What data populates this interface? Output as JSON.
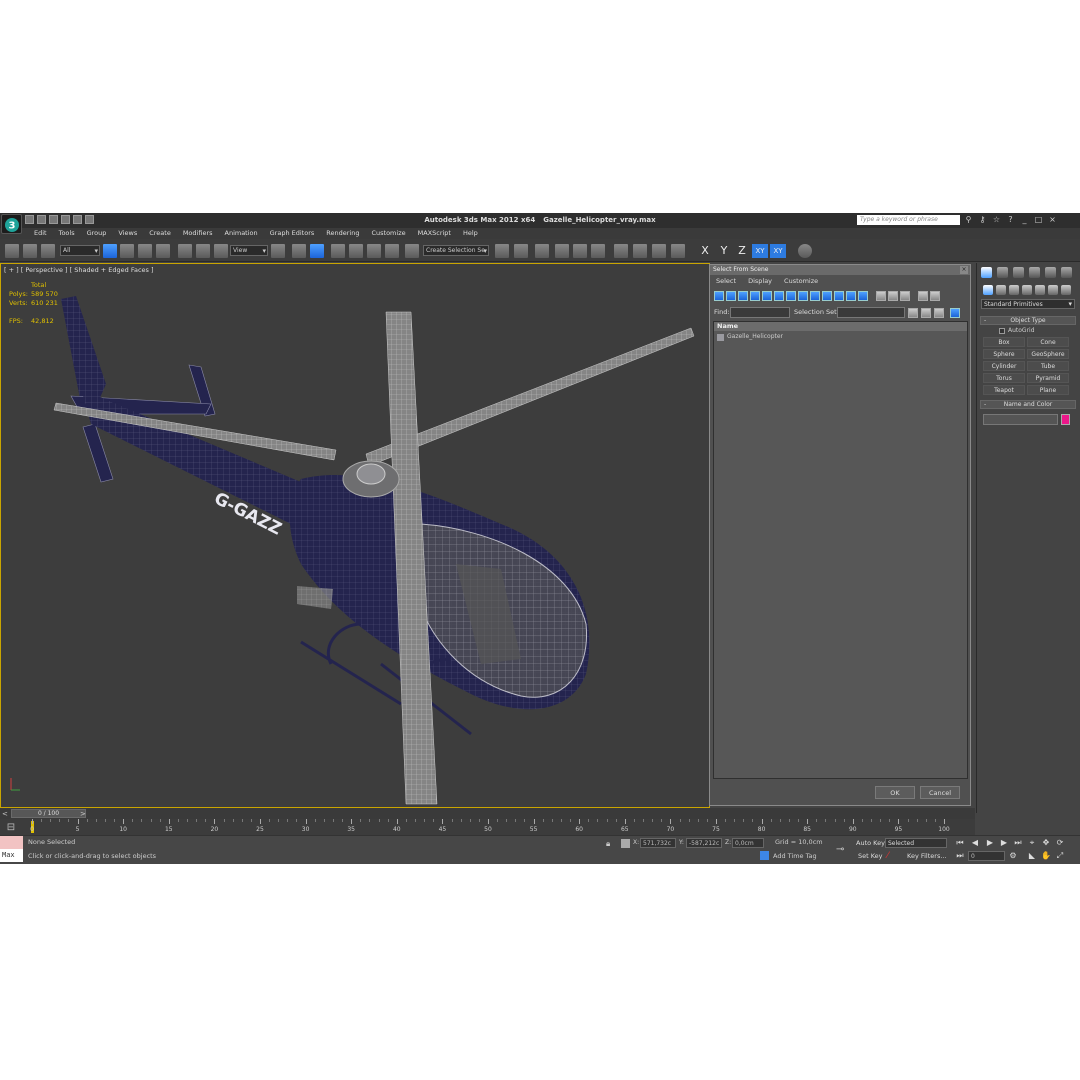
{
  "app": {
    "title": "Autodesk 3ds Max  2012 x64",
    "filename": "Gazelle_Helicopter_vray.max",
    "search_placeholder": "Type a keyword or phrase"
  },
  "menu": [
    "Edit",
    "Tools",
    "Group",
    "Views",
    "Create",
    "Modifiers",
    "Animation",
    "Graph Editors",
    "Rendering",
    "Customize",
    "MAXScript",
    "Help"
  ],
  "toolbar": {
    "filter_value": "All",
    "refcoord_value": "View",
    "named_selection_value": "Create Selection Se",
    "axes": [
      "X",
      "Y",
      "Z",
      "XY",
      "XY"
    ]
  },
  "viewport": {
    "label": "[ + ] [ Perspective ] [ Shaded + Edged Faces ]",
    "stats": {
      "header": "Total",
      "polys_label": "Polys:",
      "polys_value": "589 570",
      "verts_label": "Verts:",
      "verts_value": "610 231",
      "fps_label": "FPS:",
      "fps_value": "42,812"
    },
    "registration": "G-GAZZ"
  },
  "dialog": {
    "title": "Select From Scene",
    "menu": [
      "Select",
      "Display",
      "Customize"
    ],
    "find_label": "Find:",
    "selection_set_label": "Selection Set:",
    "column_name": "Name",
    "items": [
      "Gazelle_Helicopter"
    ],
    "ok_label": "OK",
    "cancel_label": "Cancel"
  },
  "command_panel": {
    "dropdown_value": "Standard Primitives",
    "object_type_title": "Object Type",
    "autogrid_label": "AutoGrid",
    "buttons": [
      "Box",
      "Cone",
      "Sphere",
      "GeoSphere",
      "Cylinder",
      "Tube",
      "Torus",
      "Pyramid",
      "Teapot",
      "Plane"
    ],
    "name_color_title": "Name and Color",
    "swatch_color": "#ec178a"
  },
  "timeline": {
    "slider_label": "0 / 100",
    "ticks": [
      "0",
      "5",
      "10",
      "15",
      "20",
      "25",
      "30",
      "35",
      "40",
      "45",
      "50",
      "55",
      "60",
      "65",
      "70",
      "75",
      "80",
      "85",
      "90",
      "95",
      "100"
    ]
  },
  "status": {
    "maxscript_label": "Max",
    "selection": "None Selected",
    "prompt": "Click or click-and-drag to select objects",
    "x_label": "X:",
    "x_value": "571,732c",
    "y_label": "Y:",
    "y_value": "-587,212c",
    "z_label": "Z:",
    "z_value": "0,0cm",
    "grid": "Grid = 10,0cm",
    "add_time_tag": "Add Time Tag",
    "auto_key": "Auto Key",
    "selected_value": "Selected",
    "set_key": "Set Key",
    "key_filters": "Key Filters...",
    "frame_value": "0"
  },
  "colors": {
    "accent_blue": "#2d7be0",
    "viewport_border": "#c9a500",
    "stats_yellow": "#e0c000",
    "fuselage": "#24244e"
  }
}
